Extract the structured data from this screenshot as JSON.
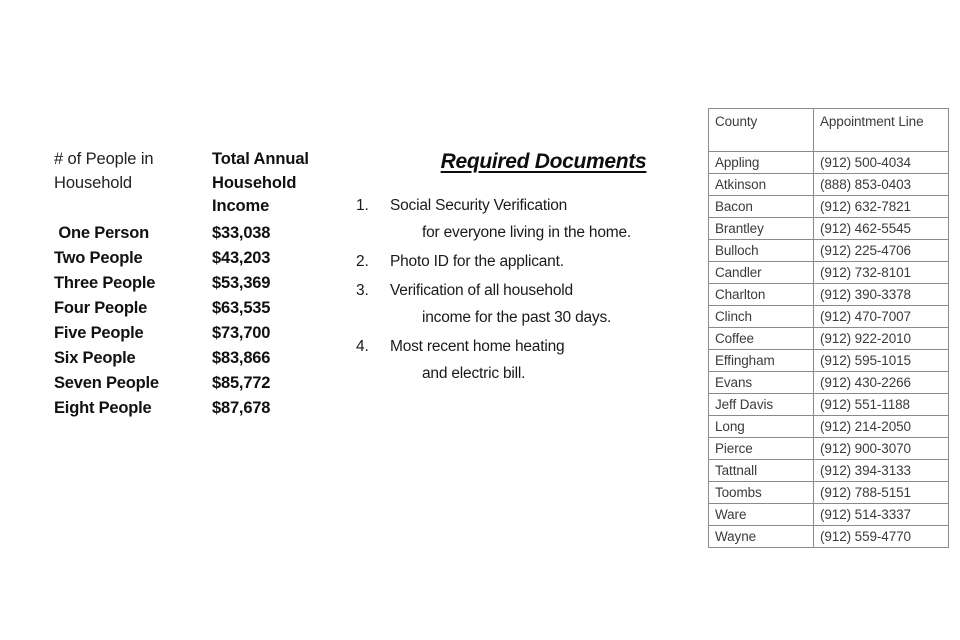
{
  "income_table": {
    "header_people": "# of People in\nHousehold",
    "header_income": "Total Annual\nHousehold\nIncome",
    "rows": [
      {
        "people": " One Person",
        "income": "$33,038"
      },
      {
        "people": "Two People",
        "income": "$43,203"
      },
      {
        "people": "Three People",
        "income": "$53,369"
      },
      {
        "people": "Four People",
        "income": "$63,535"
      },
      {
        "people": "Five People",
        "income": "$73,700"
      },
      {
        "people": "Six People",
        "income": "$83,866"
      },
      {
        "people": "Seven People",
        "income": "$85,772"
      },
      {
        "people": "Eight People",
        "income": "$87,678"
      }
    ]
  },
  "required_documents": {
    "title": "Required Documents",
    "items": [
      {
        "number": "1.",
        "line1": "Social Security Verification",
        "line2": "for everyone living in the home."
      },
      {
        "number": "2.",
        "line1": "Photo ID for the applicant.",
        "line2": ""
      },
      {
        "number": "3.",
        "line1": "Verification of all household",
        "line2": "income for the past 30 days."
      },
      {
        "number": "4.",
        "line1": "Most recent home heating",
        "line2": "and electric bill."
      }
    ]
  },
  "county_table": {
    "header_county": "County",
    "header_line": "Appointment Line",
    "rows": [
      {
        "county": "Appling",
        "phone": "(912) 500-4034"
      },
      {
        "county": "Atkinson",
        "phone": "(888) 853-0403"
      },
      {
        "county": "Bacon",
        "phone": "(912) 632-7821"
      },
      {
        "county": "Brantley",
        "phone": "(912) 462-5545"
      },
      {
        "county": "Bulloch",
        "phone": "(912) 225-4706"
      },
      {
        "county": "Candler",
        "phone": "(912) 732-8101"
      },
      {
        "county": "Charlton",
        "phone": "(912) 390-3378"
      },
      {
        "county": "Clinch",
        "phone": "(912) 470-7007"
      },
      {
        "county": "Coffee",
        "phone": "(912) 922-2010"
      },
      {
        "county": "Effingham",
        "phone": "(912) 595-1015"
      },
      {
        "county": "Evans",
        "phone": "(912) 430-2266"
      },
      {
        "county": "Jeff Davis",
        "phone": "(912) 551-1188"
      },
      {
        "county": "Long",
        "phone": "(912) 214-2050"
      },
      {
        "county": "Pierce",
        "phone": "(912) 900-3070"
      },
      {
        "county": "Tattnall",
        "phone": "(912) 394-3133"
      },
      {
        "county": "Toombs",
        "phone": "(912) 788-5151"
      },
      {
        "county": "Ware",
        "phone": "(912) 514-3337"
      },
      {
        "county": "Wayne",
        "phone": "(912) 559-4770"
      }
    ]
  },
  "colors": {
    "background": "#ffffff",
    "body_text": "#111111",
    "table_text": "#3b3b3b",
    "table_border": "#8a8a8a"
  }
}
